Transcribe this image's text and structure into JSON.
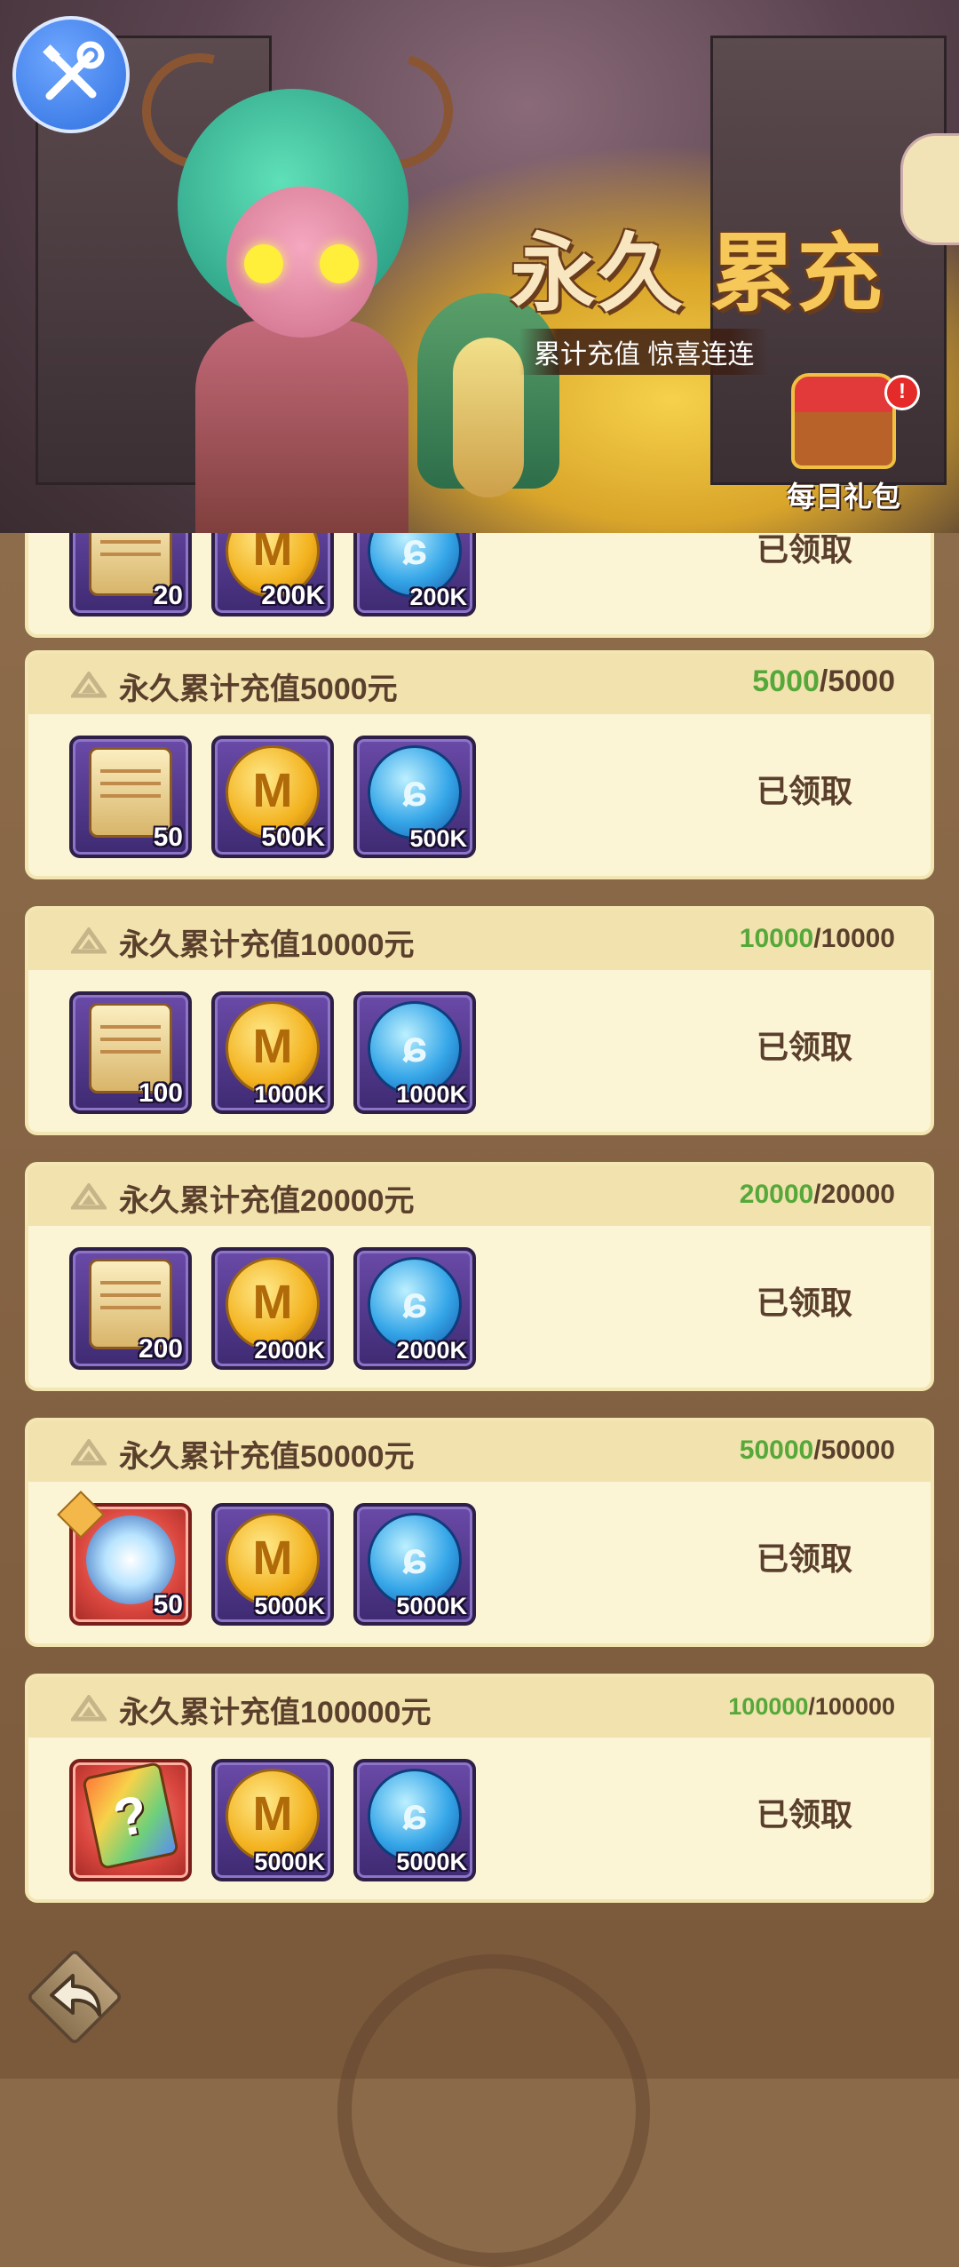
{
  "banner": {
    "title_part1": "永久",
    "title_part2": "累充",
    "subtitle": "累计充值 惊喜连连",
    "daily_gift_label": "每日礼包",
    "daily_gift_badge": "!"
  },
  "colors": {
    "progress_current": "#56a83a",
    "card_bg": "#fbf5d6",
    "card_header": "#f1e2ae",
    "text_brown": "#5a3f2c"
  },
  "partial_card": {
    "claim_label": "已领取",
    "rewards": [
      {
        "icon": "scroll-icon",
        "qty": "20"
      },
      {
        "icon": "gold-coin-icon",
        "qty": "200K"
      },
      {
        "icon": "blue-orb-icon",
        "qty": "200K"
      }
    ]
  },
  "cards": [
    {
      "title": "永久累计充值5000元",
      "progress_current": "5000",
      "progress_total": "/5000",
      "claim_label": "已领取",
      "rewards": [
        {
          "icon": "scroll-icon",
          "qty": "50"
        },
        {
          "icon": "gold-coin-icon",
          "qty": "500K"
        },
        {
          "icon": "blue-orb-icon",
          "qty": "500K"
        }
      ]
    },
    {
      "title": "永久累计充值10000元",
      "progress_current": "10000",
      "progress_total": "/10000",
      "claim_label": "已领取",
      "rewards": [
        {
          "icon": "scroll-icon",
          "qty": "100"
        },
        {
          "icon": "gold-coin-icon",
          "qty": "1000K"
        },
        {
          "icon": "blue-orb-icon",
          "qty": "1000K"
        }
      ]
    },
    {
      "title": "永久累计充值20000元",
      "progress_current": "20000",
      "progress_total": "/20000",
      "claim_label": "已领取",
      "rewards": [
        {
          "icon": "scroll-icon",
          "qty": "200"
        },
        {
          "icon": "gold-coin-icon",
          "qty": "2000K"
        },
        {
          "icon": "blue-orb-icon",
          "qty": "2000K"
        }
      ]
    },
    {
      "title": "永久累计充值50000元",
      "progress_current": "50000",
      "progress_total": "/50000",
      "claim_label": "已领取",
      "rewards": [
        {
          "icon": "hero-shard-icon",
          "qty": "50"
        },
        {
          "icon": "gold-coin-icon",
          "qty": "5000K"
        },
        {
          "icon": "blue-orb-icon",
          "qty": "5000K"
        }
      ]
    },
    {
      "title": "永久累计充值100000元",
      "progress_current": "100000",
      "progress_total": "/100000",
      "claim_label": "已领取",
      "rewards": [
        {
          "icon": "mystery-card-icon",
          "qty": ""
        },
        {
          "icon": "gold-coin-icon",
          "qty": "5000K"
        },
        {
          "icon": "blue-orb-icon",
          "qty": "5000K"
        }
      ]
    }
  ]
}
